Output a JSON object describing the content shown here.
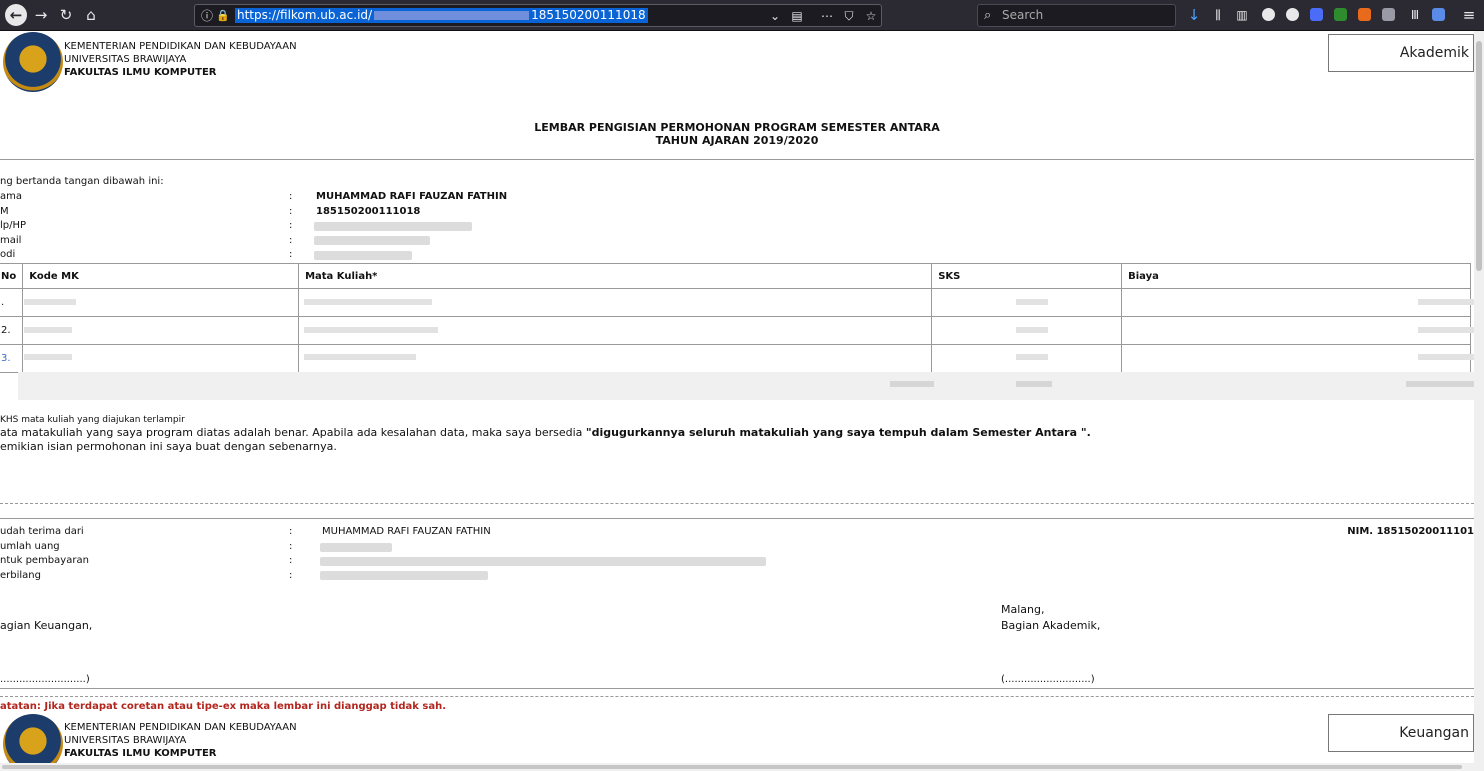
{
  "browser": {
    "url": "https://filkom.ub.ac.id/",
    "url_tail": "185150200111018",
    "search_placeholder": "Search"
  },
  "header": {
    "line1": "KEMENTERIAN PENDIDIKAN DAN KEBUDAYAAN",
    "line2": "UNIVERSITAS BRAWIJAYA",
    "line3": "FAKULTAS ILMU KOMPUTER",
    "copy_label_top": "Akademik",
    "copy_label_bottom": "Keuangan"
  },
  "form": {
    "title1": "LEMBAR PENGISIAN PERMOHONAN PROGRAM SEMESTER ANTARA",
    "title2": "TAHUN AJARAN 2019/2020",
    "intro": "ng bertanda tangan dibawah ini:",
    "fields": [
      {
        "label": "ama",
        "sep": ":",
        "value": "MUHAMMAD RAFI FAUZAN FATHIN"
      },
      {
        "label": "M",
        "sep": ":",
        "value": "185150200111018"
      },
      {
        "label": "lp/HP",
        "sep": ":",
        "value": ""
      },
      {
        "label": "mail",
        "sep": ":",
        "value": ""
      },
      {
        "label": "odi",
        "sep": ":",
        "value": ""
      }
    ],
    "table": {
      "headers": [
        "No",
        "Kode MK",
        "Mata Kuliah*",
        "SKS",
        "Biaya"
      ],
      "row_numbers": [
        ".",
        "2.",
        "3."
      ]
    },
    "note_small": "KHS mata kuliah yang diajukan terlampir",
    "statement_pre": "ata matakuliah yang saya program diatas adalah benar. Apabila ada kesalahan data, maka saya bersedia ",
    "statement_bold": "\"digugurkannya seluruh matakuliah yang saya tempuh dalam Semester Antara \".",
    "statement2": "emikian isian permohonan ini saya buat dengan sebenarnya."
  },
  "receipt": {
    "fields": [
      {
        "label": "udah terima dari",
        "sep": ":",
        "value": "MUHAMMAD RAFI FAUZAN FATHIN"
      },
      {
        "label": "umlah uang",
        "sep": ":",
        "value": ""
      },
      {
        "label": "ntuk pembayaran",
        "sep": ":",
        "value": ""
      },
      {
        "label": "erbilang",
        "sep": ":",
        "value": ""
      }
    ],
    "nim": "NIM. 18515020011101",
    "left_sign": "agian Keuangan,",
    "city": "Malang,",
    "right_sign": "Bagian Akademik,",
    "left_blank": "...........................)",
    "right_blank": "(...........................)"
  },
  "footer_note": "atatan: Jika terdapat coretan atau tipe-ex maka lembar ini dianggap tidak sah."
}
